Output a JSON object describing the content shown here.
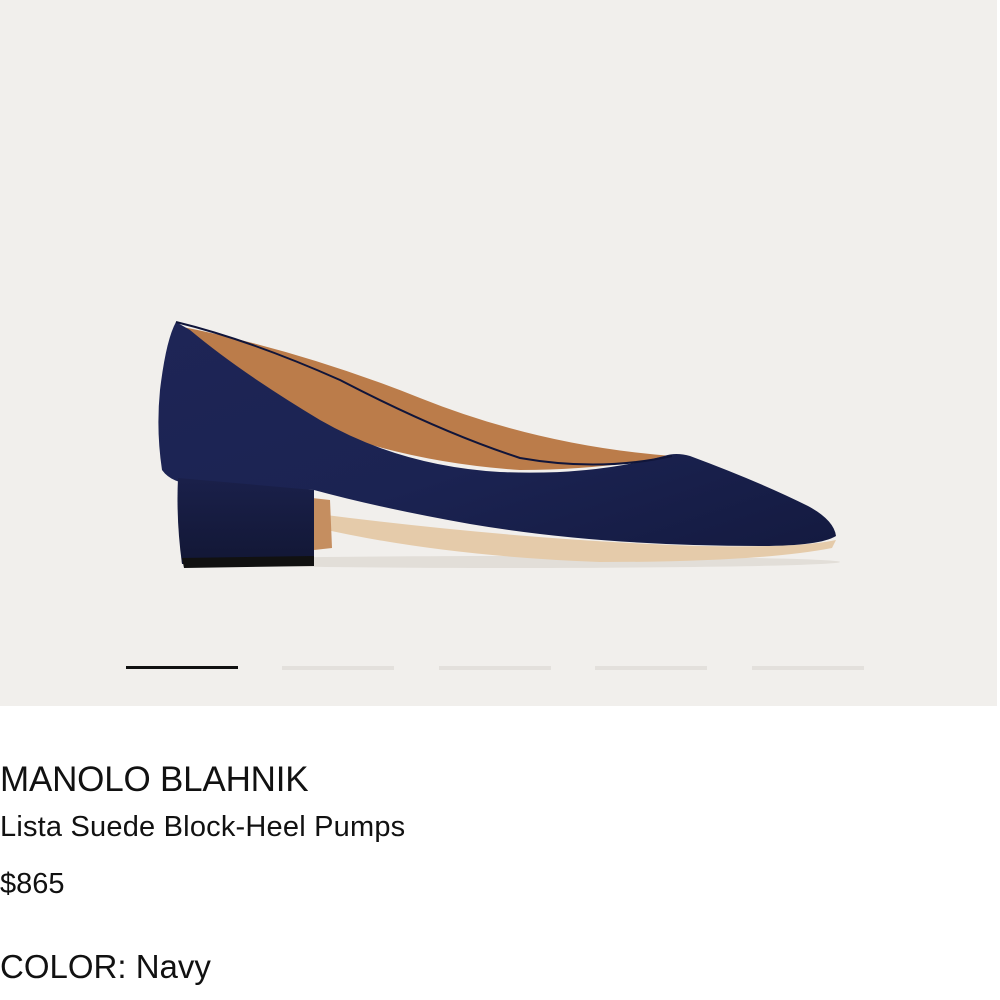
{
  "gallery": {
    "image_alt": "Lista Suede Block-Heel Pumps - navy suede pump, side view",
    "slide_count": 5,
    "active_slide": 1
  },
  "product": {
    "brand": "MANOLO BLAHNIK",
    "name": "Lista Suede Block-Heel Pumps",
    "price": "$865",
    "color_label": "COLOR:",
    "color_value": "Navy"
  },
  "colors": {
    "background": "#f1efec",
    "shoe": "#1c2350",
    "lining": "#b97a4a",
    "sole": "#e3c7a8"
  }
}
